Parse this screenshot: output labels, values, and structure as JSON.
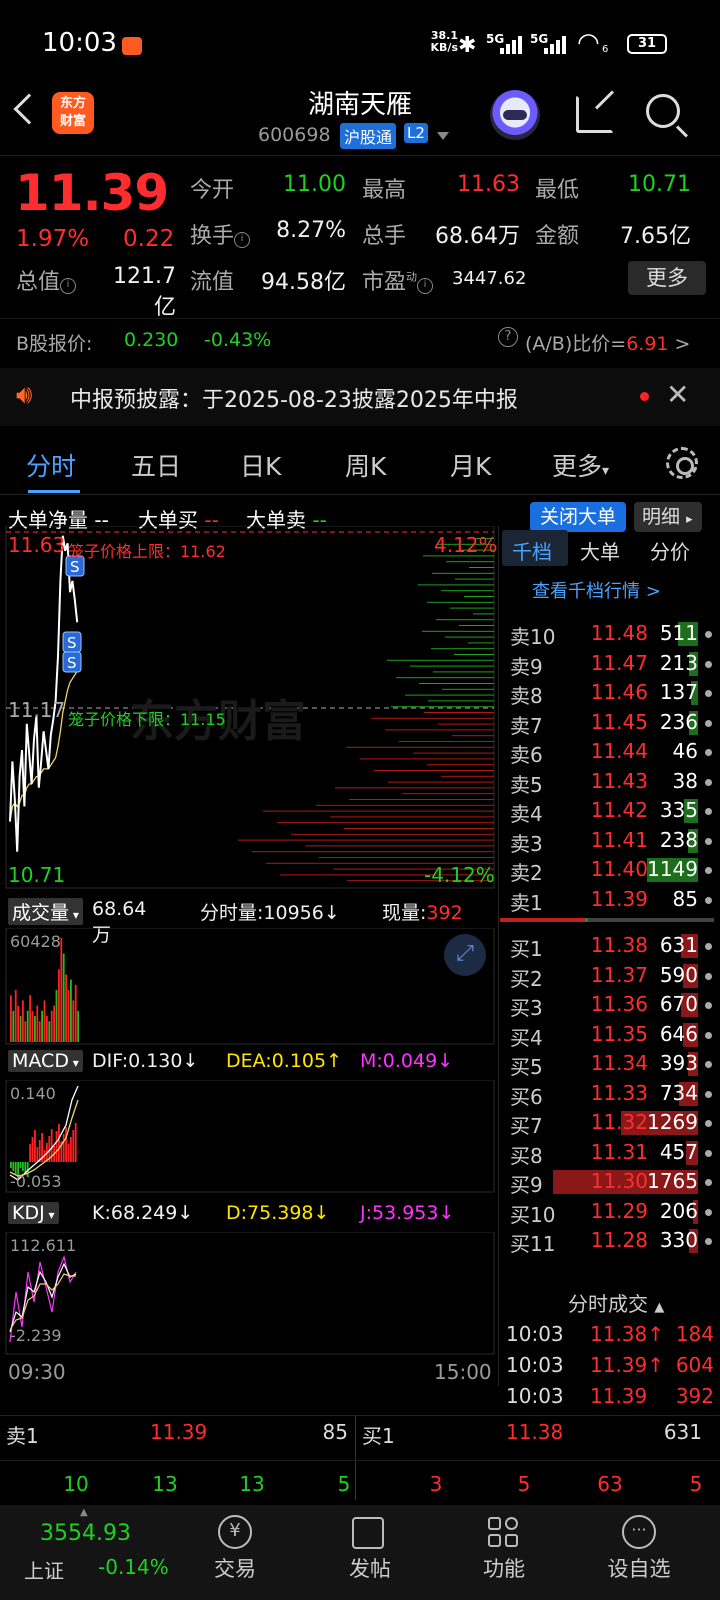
{
  "status": {
    "time": "10:03",
    "net_speed_top": "38.1",
    "net_speed_unit": "KB/s",
    "sig1": "5G",
    "sig2": "5G",
    "wifi_num": "6",
    "battery": "31"
  },
  "header": {
    "name": "湖南天雁",
    "code": "600698",
    "badge_hgt": "沪股通",
    "badge_l2": "L2"
  },
  "quote": {
    "price": "11.39",
    "pct": "1.97%",
    "change": "0.22",
    "open_label": "今开",
    "open": "11.00",
    "high_label": "最高",
    "high": "11.63",
    "low_label": "最低",
    "low": "10.71",
    "turnover_label": "换手",
    "turnover": "8.27%",
    "volume_label": "总手",
    "volume": "68.64万",
    "amount_label": "金额",
    "amount": "7.65亿",
    "mcap_label": "总值",
    "mcap": "121.7亿",
    "float_label": "流值",
    "float": "94.58亿",
    "pe_label": "市盈",
    "pe_sup": "动",
    "pe": "3447.62",
    "more": "更多"
  },
  "bshare": {
    "label": "B股报价:",
    "price": "0.230",
    "pct": "-0.43%",
    "ratio_label": "(A/B)比价=",
    "ratio": "6.91",
    "arrow": ">"
  },
  "notice": {
    "text": "中报预披露：于2025-08-23披露2025年中报"
  },
  "tabs": [
    "分时",
    "五日",
    "日K",
    "周K",
    "月K",
    "更多"
  ],
  "chart": {
    "legend_net": "大单净量",
    "legend_net_val": "--",
    "legend_buy": "大单买",
    "legend_buy_val": "--",
    "legend_sell": "大单卖",
    "legend_sell_val": "--",
    "close_big": "关闭大单",
    "detail": "明细",
    "y_top": "11.63",
    "y_mid": "11.17",
    "y_bot": "10.71",
    "pct_top": "4.12%",
    "pct_bot": "-4.12%",
    "upper_limit": "笼子价格上限：11.62",
    "lower_limit": "笼子价格下限：11.15",
    "watermark": "东方财富",
    "price_line": [
      10.86,
      11.02,
      10.92,
      10.78,
      10.98,
      11.05,
      10.9,
      11.12,
      11.04,
      10.96,
      11.08,
      11.14,
      10.95,
      11.02,
      11.1,
      11.05,
      11.0,
      11.09,
      11.13,
      11.18,
      11.3,
      11.5,
      11.62,
      11.58,
      11.6,
      11.47,
      11.5,
      11.45,
      11.39
    ],
    "avg_line": [
      10.86,
      10.9,
      10.91,
      10.9,
      10.91,
      10.93,
      10.93,
      10.95,
      10.96,
      10.96,
      10.97,
      10.98,
      10.98,
      10.99,
      11.0,
      11.0,
      11.0,
      11.01,
      11.02,
      11.03,
      11.06,
      11.1,
      11.15,
      11.18,
      11.21,
      11.23,
      11.24,
      11.25,
      11.26
    ]
  },
  "volume": {
    "label": "成交量",
    "total": "68.64万",
    "minute_label": "分时量:",
    "minute": "10956",
    "minute_arrow": "↓",
    "now_label": "现量:",
    "now": "392",
    "max": "60428",
    "bars": [
      0.45,
      0.3,
      0.5,
      0.35,
      0.25,
      0.4,
      0.2,
      0.3,
      0.45,
      0.3,
      0.25,
      0.35,
      0.2,
      0.3,
      0.4,
      0.25,
      0.2,
      0.3,
      0.35,
      0.5,
      0.7,
      1.0,
      0.85,
      0.65,
      0.5,
      0.6,
      0.4,
      0.55,
      0.3
    ]
  },
  "macd": {
    "label": "MACD",
    "dif": "DIF:0.130",
    "dif_arrow": "↓",
    "dea": "DEA:0.105",
    "dea_arrow": "↑",
    "m": "M:0.049",
    "m_arrow": "↓",
    "top": "0.140",
    "bot": "-0.053"
  },
  "kdj": {
    "label": "KDJ",
    "k": "K:68.249",
    "k_arrow": "↓",
    "d": "D:75.398",
    "d_arrow": "↓",
    "j": "J:53.953",
    "j_arrow": "↓",
    "top": "112.611",
    "bot": "-2.239"
  },
  "time_axis": {
    "start": "09:30",
    "end": "15:00"
  },
  "orderbook": {
    "tabs": [
      "千档",
      "大单",
      "分价"
    ],
    "view_all": "查看千档行情 >",
    "sells": [
      {
        "label": "卖10",
        "price": "11.48",
        "vol": "511",
        "bar": 0.12
      },
      {
        "label": "卖9",
        "price": "11.47",
        "vol": "213",
        "bar": 0.05
      },
      {
        "label": "卖8",
        "price": "11.46",
        "vol": "137",
        "bar": 0.04
      },
      {
        "label": "卖7",
        "price": "11.45",
        "vol": "236",
        "bar": 0.05
      },
      {
        "label": "卖6",
        "price": "11.44",
        "vol": "46",
        "bar": 0.0
      },
      {
        "label": "卖5",
        "price": "11.43",
        "vol": "38",
        "bar": 0.0
      },
      {
        "label": "卖4",
        "price": "11.42",
        "vol": "335",
        "bar": 0.08
      },
      {
        "label": "卖3",
        "price": "11.41",
        "vol": "238",
        "bar": 0.06
      },
      {
        "label": "卖2",
        "price": "11.40",
        "vol": "1149",
        "bar": 0.3
      },
      {
        "label": "卖1",
        "price": "11.39",
        "vol": "85",
        "bar": 0.0
      }
    ],
    "buys": [
      {
        "label": "买1",
        "price": "11.38",
        "vol": "631",
        "bar": 0.1
      },
      {
        "label": "买2",
        "price": "11.37",
        "vol": "590",
        "bar": 0.09
      },
      {
        "label": "买3",
        "price": "11.36",
        "vol": "670",
        "bar": 0.1
      },
      {
        "label": "买4",
        "price": "11.35",
        "vol": "646",
        "bar": 0.09
      },
      {
        "label": "买5",
        "price": "11.34",
        "vol": "393",
        "bar": 0.06
      },
      {
        "label": "买6",
        "price": "11.33",
        "vol": "734",
        "bar": 0.11
      },
      {
        "label": "买7",
        "price": "11.32",
        "vol": "1269",
        "bar": 0.45
      },
      {
        "label": "买8",
        "price": "11.31",
        "vol": "457",
        "bar": 0.07
      },
      {
        "label": "买9",
        "price": "11.30",
        "vol": "1765",
        "bar": 0.85
      },
      {
        "label": "买10",
        "price": "11.29",
        "vol": "206",
        "bar": 0.03
      },
      {
        "label": "买11",
        "price": "11.28",
        "vol": "330",
        "bar": 0.05
      }
    ],
    "trades_title": "分时成交",
    "trades": [
      {
        "time": "10:03",
        "price": "11.38",
        "arrow": "↑",
        "vol": "184"
      },
      {
        "time": "10:03",
        "price": "11.39",
        "arrow": "↑",
        "vol": "604"
      },
      {
        "time": "10:03",
        "price": "11.39",
        "arrow": "",
        "vol": "392"
      }
    ]
  },
  "bottom_quote": {
    "sell_label": "卖1",
    "sell_price": "11.39",
    "sell_vol": "85",
    "buy_label": "买1",
    "buy_price": "11.38",
    "buy_vol": "631",
    "left_nums": [
      "10",
      "13",
      "13",
      "5"
    ],
    "right_nums": [
      "3",
      "5",
      "63",
      "5"
    ]
  },
  "navbar": {
    "index_val": "3554.93",
    "index_name": "上证",
    "index_pct": "-0.14%",
    "items": [
      "交易",
      "发帖",
      "功能",
      "设自选"
    ]
  }
}
